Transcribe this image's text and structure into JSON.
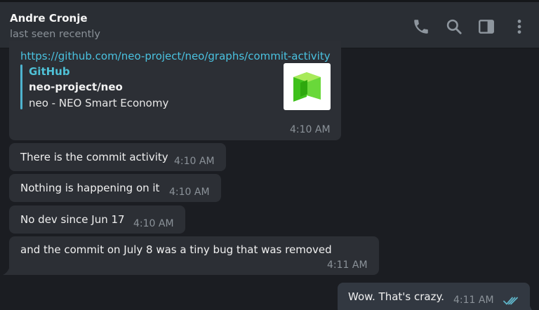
{
  "header": {
    "contact_name": "Andre Cronje",
    "status": "last seen recently",
    "icons": [
      "phone-icon",
      "search-icon",
      "sidebar-toggle-icon",
      "more-vertical-icon"
    ]
  },
  "messages": [
    {
      "id": "m1",
      "link": "https://github.com/neo-project/neo/graphs/commit-activity",
      "preview": {
        "site": "GitHub",
        "title": "neo-project/neo",
        "description": "neo - NEO Smart Economy",
        "thumbnail_icon": "neo-logo-icon"
      },
      "time": "4:10 AM"
    },
    {
      "id": "m2",
      "text": "There is the commit activity",
      "time": "4:10 AM"
    },
    {
      "id": "m3",
      "text": "Nothing is happening on it",
      "time": "4:10 AM"
    },
    {
      "id": "m4",
      "text": "No dev since Jun 17",
      "time": "4:10 AM"
    },
    {
      "id": "m5",
      "text": "and the commit on July 8 was a tiny bug that was removed",
      "time": "4:11 AM"
    },
    {
      "id": "m6",
      "text": "Wow. That's crazy.",
      "time": "4:11 AM",
      "outgoing": true,
      "status_icon": "double-check-icon"
    }
  ],
  "colors": {
    "background": "#1b1d22",
    "header": "#2a2e34",
    "incoming_bubble": "#2c2f35",
    "outgoing_bubble": "#323841",
    "link": "#4ac2e0",
    "read_ticks": "#5fb4c8"
  }
}
